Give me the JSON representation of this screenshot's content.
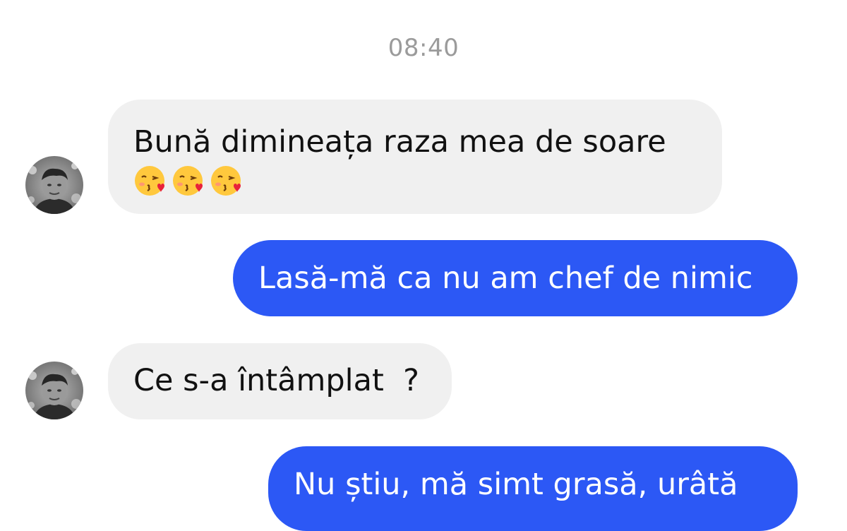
{
  "conversation": {
    "timestamp": "08:40",
    "messages": [
      {
        "direction": "incoming",
        "text": "Bună dimineața raza mea de soare",
        "emojis": [
          "kissing-heart-emoji",
          "kissing-heart-emoji",
          "kissing-heart-emoji"
        ]
      },
      {
        "direction": "outgoing",
        "text": "Lasă-mă ca nu am chef de nimic"
      },
      {
        "direction": "incoming",
        "text": "Ce s-a întâmplat  ?"
      },
      {
        "direction": "outgoing",
        "text": "Nu știu, mă simt grasă, urâtă"
      }
    ]
  },
  "colors": {
    "incoming_bubble": "#f0f0f0",
    "outgoing_bubble": "#2c58f5",
    "timestamp_text": "#9b9b9b"
  }
}
